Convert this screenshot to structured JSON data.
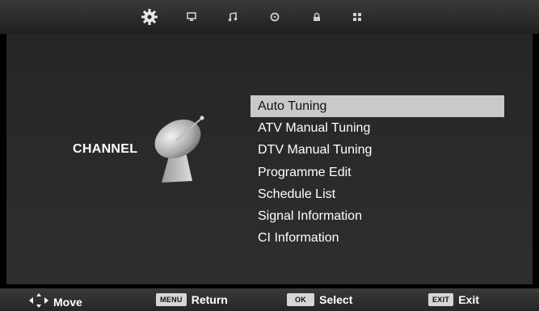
{
  "top_icons": [
    {
      "name": "channel",
      "icon": "gear-icon",
      "active": true
    },
    {
      "name": "picture",
      "icon": "monitor-icon",
      "active": false
    },
    {
      "name": "sound",
      "icon": "music-note-icon",
      "active": false
    },
    {
      "name": "time",
      "icon": "clock-icon",
      "active": false
    },
    {
      "name": "lock",
      "icon": "lock-icon",
      "active": false
    },
    {
      "name": "setup",
      "icon": "grid-icon",
      "active": false
    }
  ],
  "category": {
    "label": "CHANNEL",
    "icon": "satellite-dish-icon"
  },
  "menu": {
    "selected_index": 0,
    "items": [
      "Auto Tuning",
      "ATV Manual Tuning",
      "DTV Manual Tuning",
      "Programme Edit",
      "Schedule List",
      "Signal Information",
      "CI Information"
    ]
  },
  "hints": {
    "move": {
      "label": "Move",
      "icon": "arrow-keys-icon"
    },
    "return": {
      "key": "MENU",
      "label": "Return"
    },
    "select": {
      "key": "OK",
      "label": "Select"
    },
    "exit": {
      "key": "EXIT",
      "label": "Exit"
    }
  },
  "colors": {
    "background": "#000000",
    "panel": "#2a2a2a",
    "highlight": "#c9c9c9",
    "key_badge": "#d6d6d6"
  }
}
